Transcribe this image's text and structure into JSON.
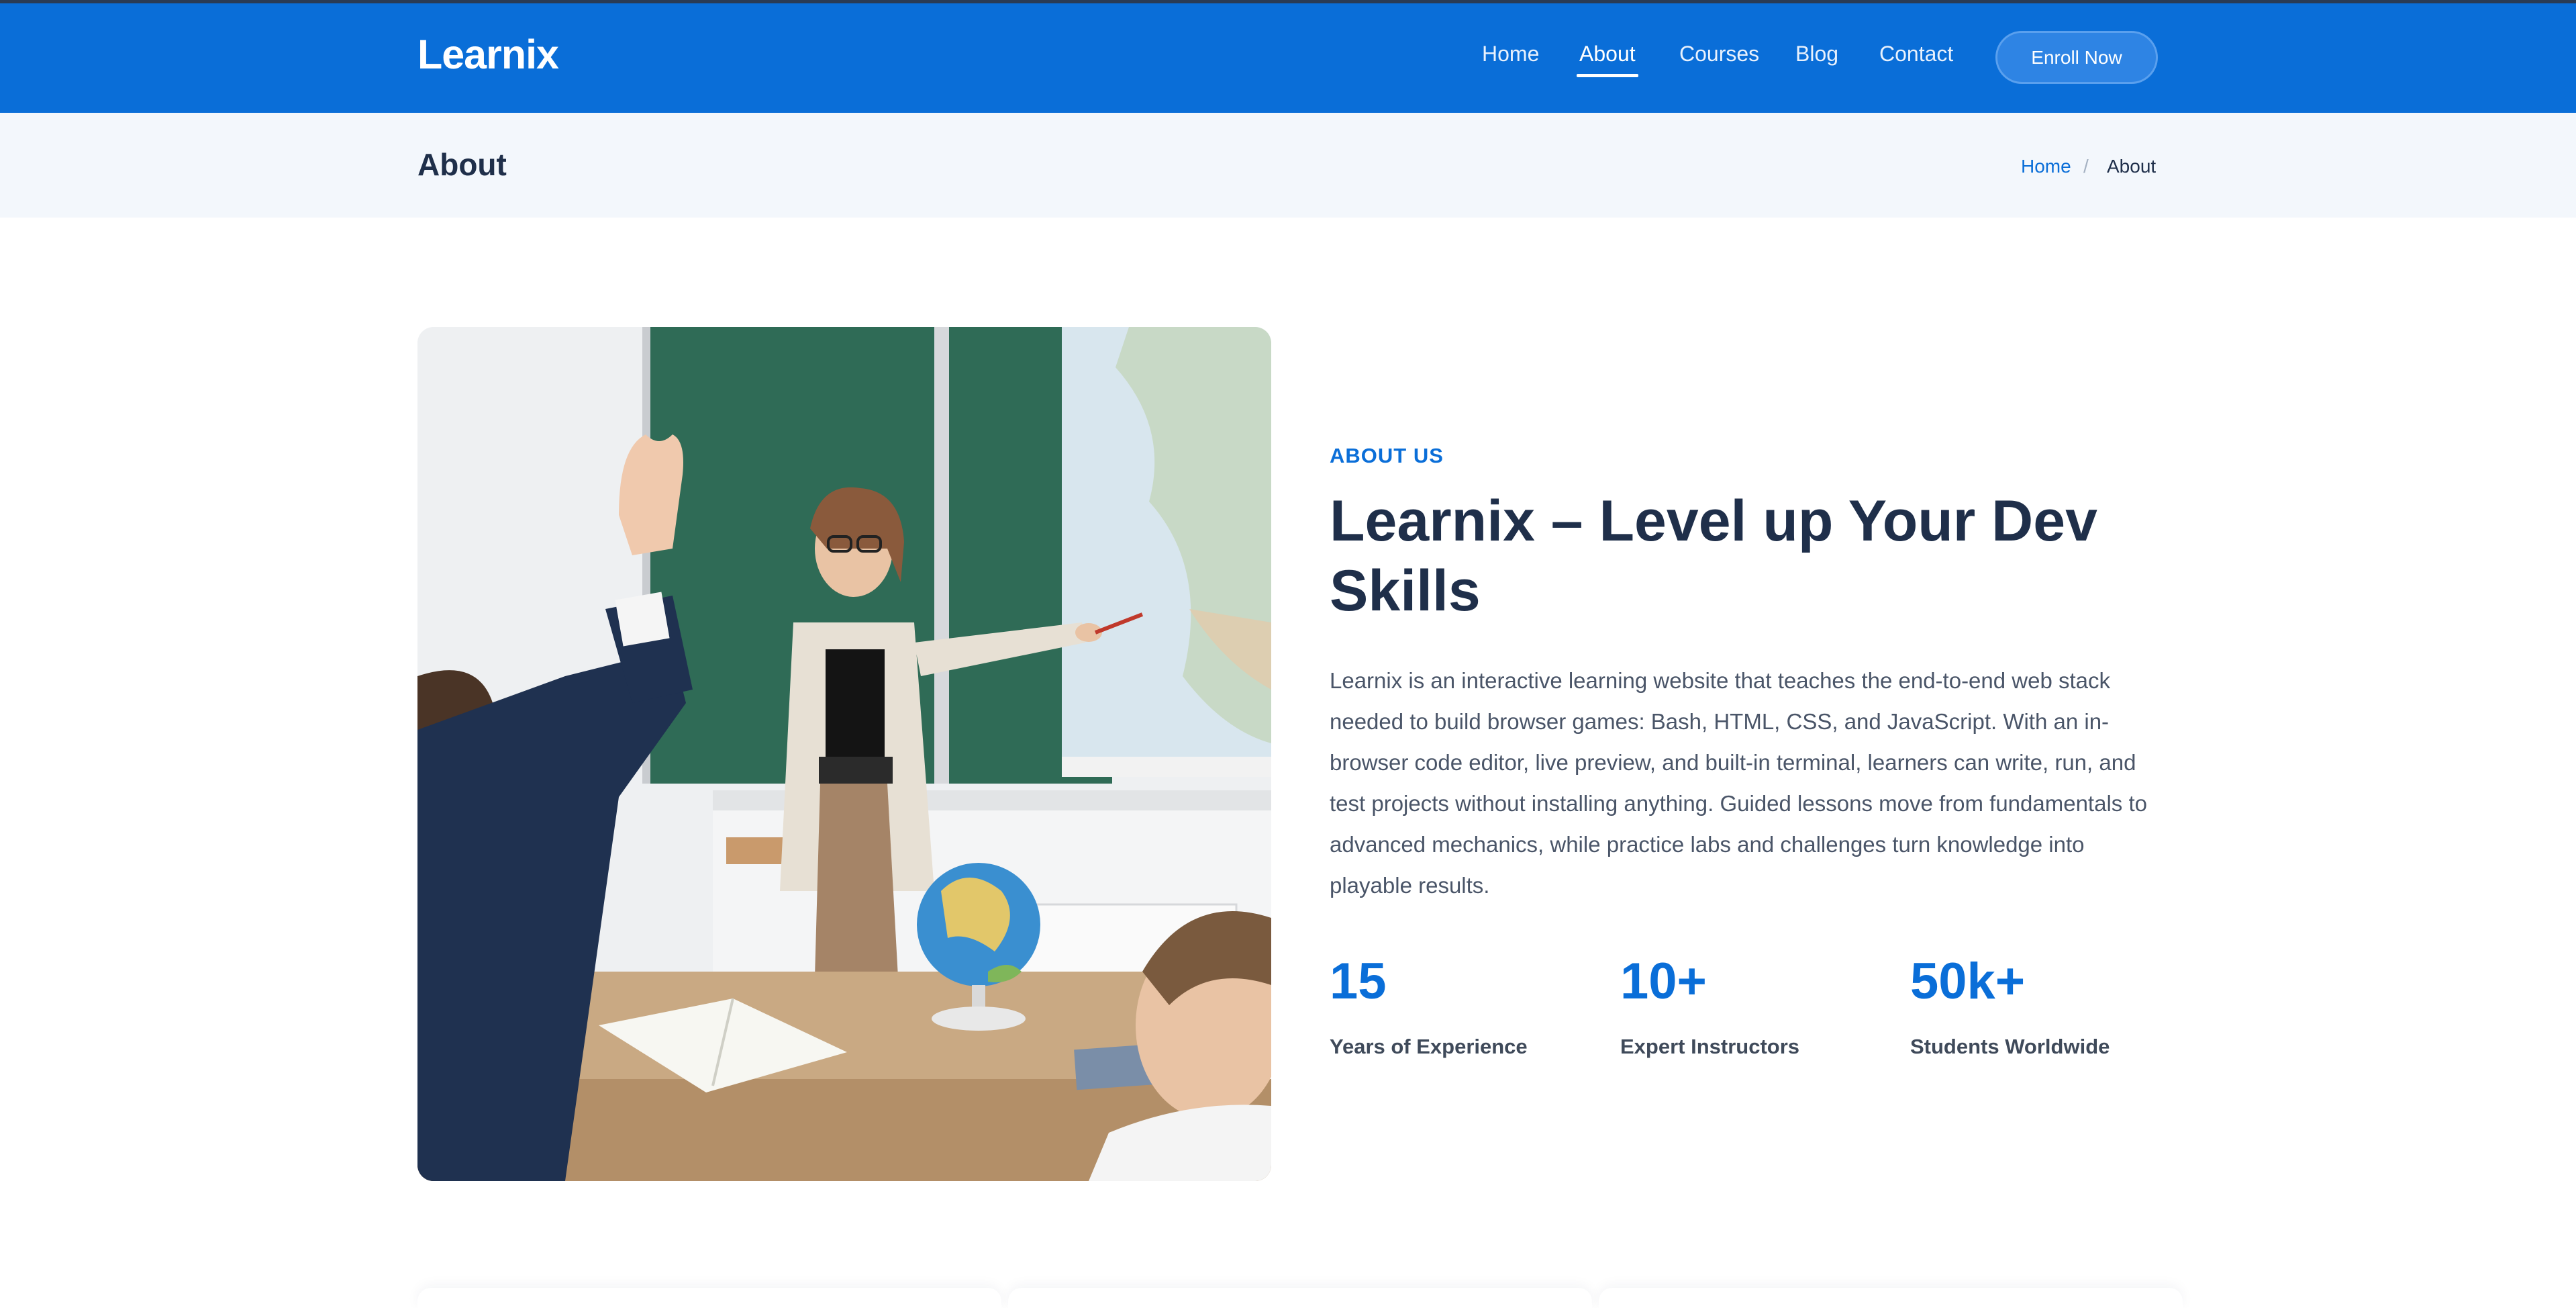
{
  "header": {
    "logo": "Learnix",
    "nav": [
      {
        "label": "Home"
      },
      {
        "label": "About"
      },
      {
        "label": "Courses"
      },
      {
        "label": "Blog"
      },
      {
        "label": "Contact"
      }
    ],
    "cta": "Enroll Now",
    "active_item": "About"
  },
  "page_title": {
    "title": "About",
    "breadcrumb": {
      "home": "Home",
      "separator": "/",
      "current": "About"
    }
  },
  "about": {
    "eyebrow": "ABOUT US",
    "headline_line1": "Learnix – Level up Your Dev",
    "headline_line2": "Skills",
    "body": "Learnix is an interactive learning website that teaches the end-to-end web stack needed to build browser games: Bash, HTML, CSS, and JavaScript. With an in-browser code editor, live preview, and built-in terminal, learners can write, run, and test projects without installing anything. Guided lessons move from fundamentals to advanced mechanics, while practice labs and challenges turn knowledge into playable results.",
    "stats": [
      {
        "value": "15",
        "label": "Years of Experience"
      },
      {
        "value": "10+",
        "label": "Expert Instructors"
      },
      {
        "value": "50k+",
        "label": "Students Worldwide"
      }
    ]
  },
  "colors": {
    "brand_blue": "#0a6ed8",
    "heading": "#1f2f4a",
    "body_text": "#4a5568",
    "title_bar_bg": "#f3f7fc"
  },
  "image": {
    "icon": "classroom-photo"
  }
}
